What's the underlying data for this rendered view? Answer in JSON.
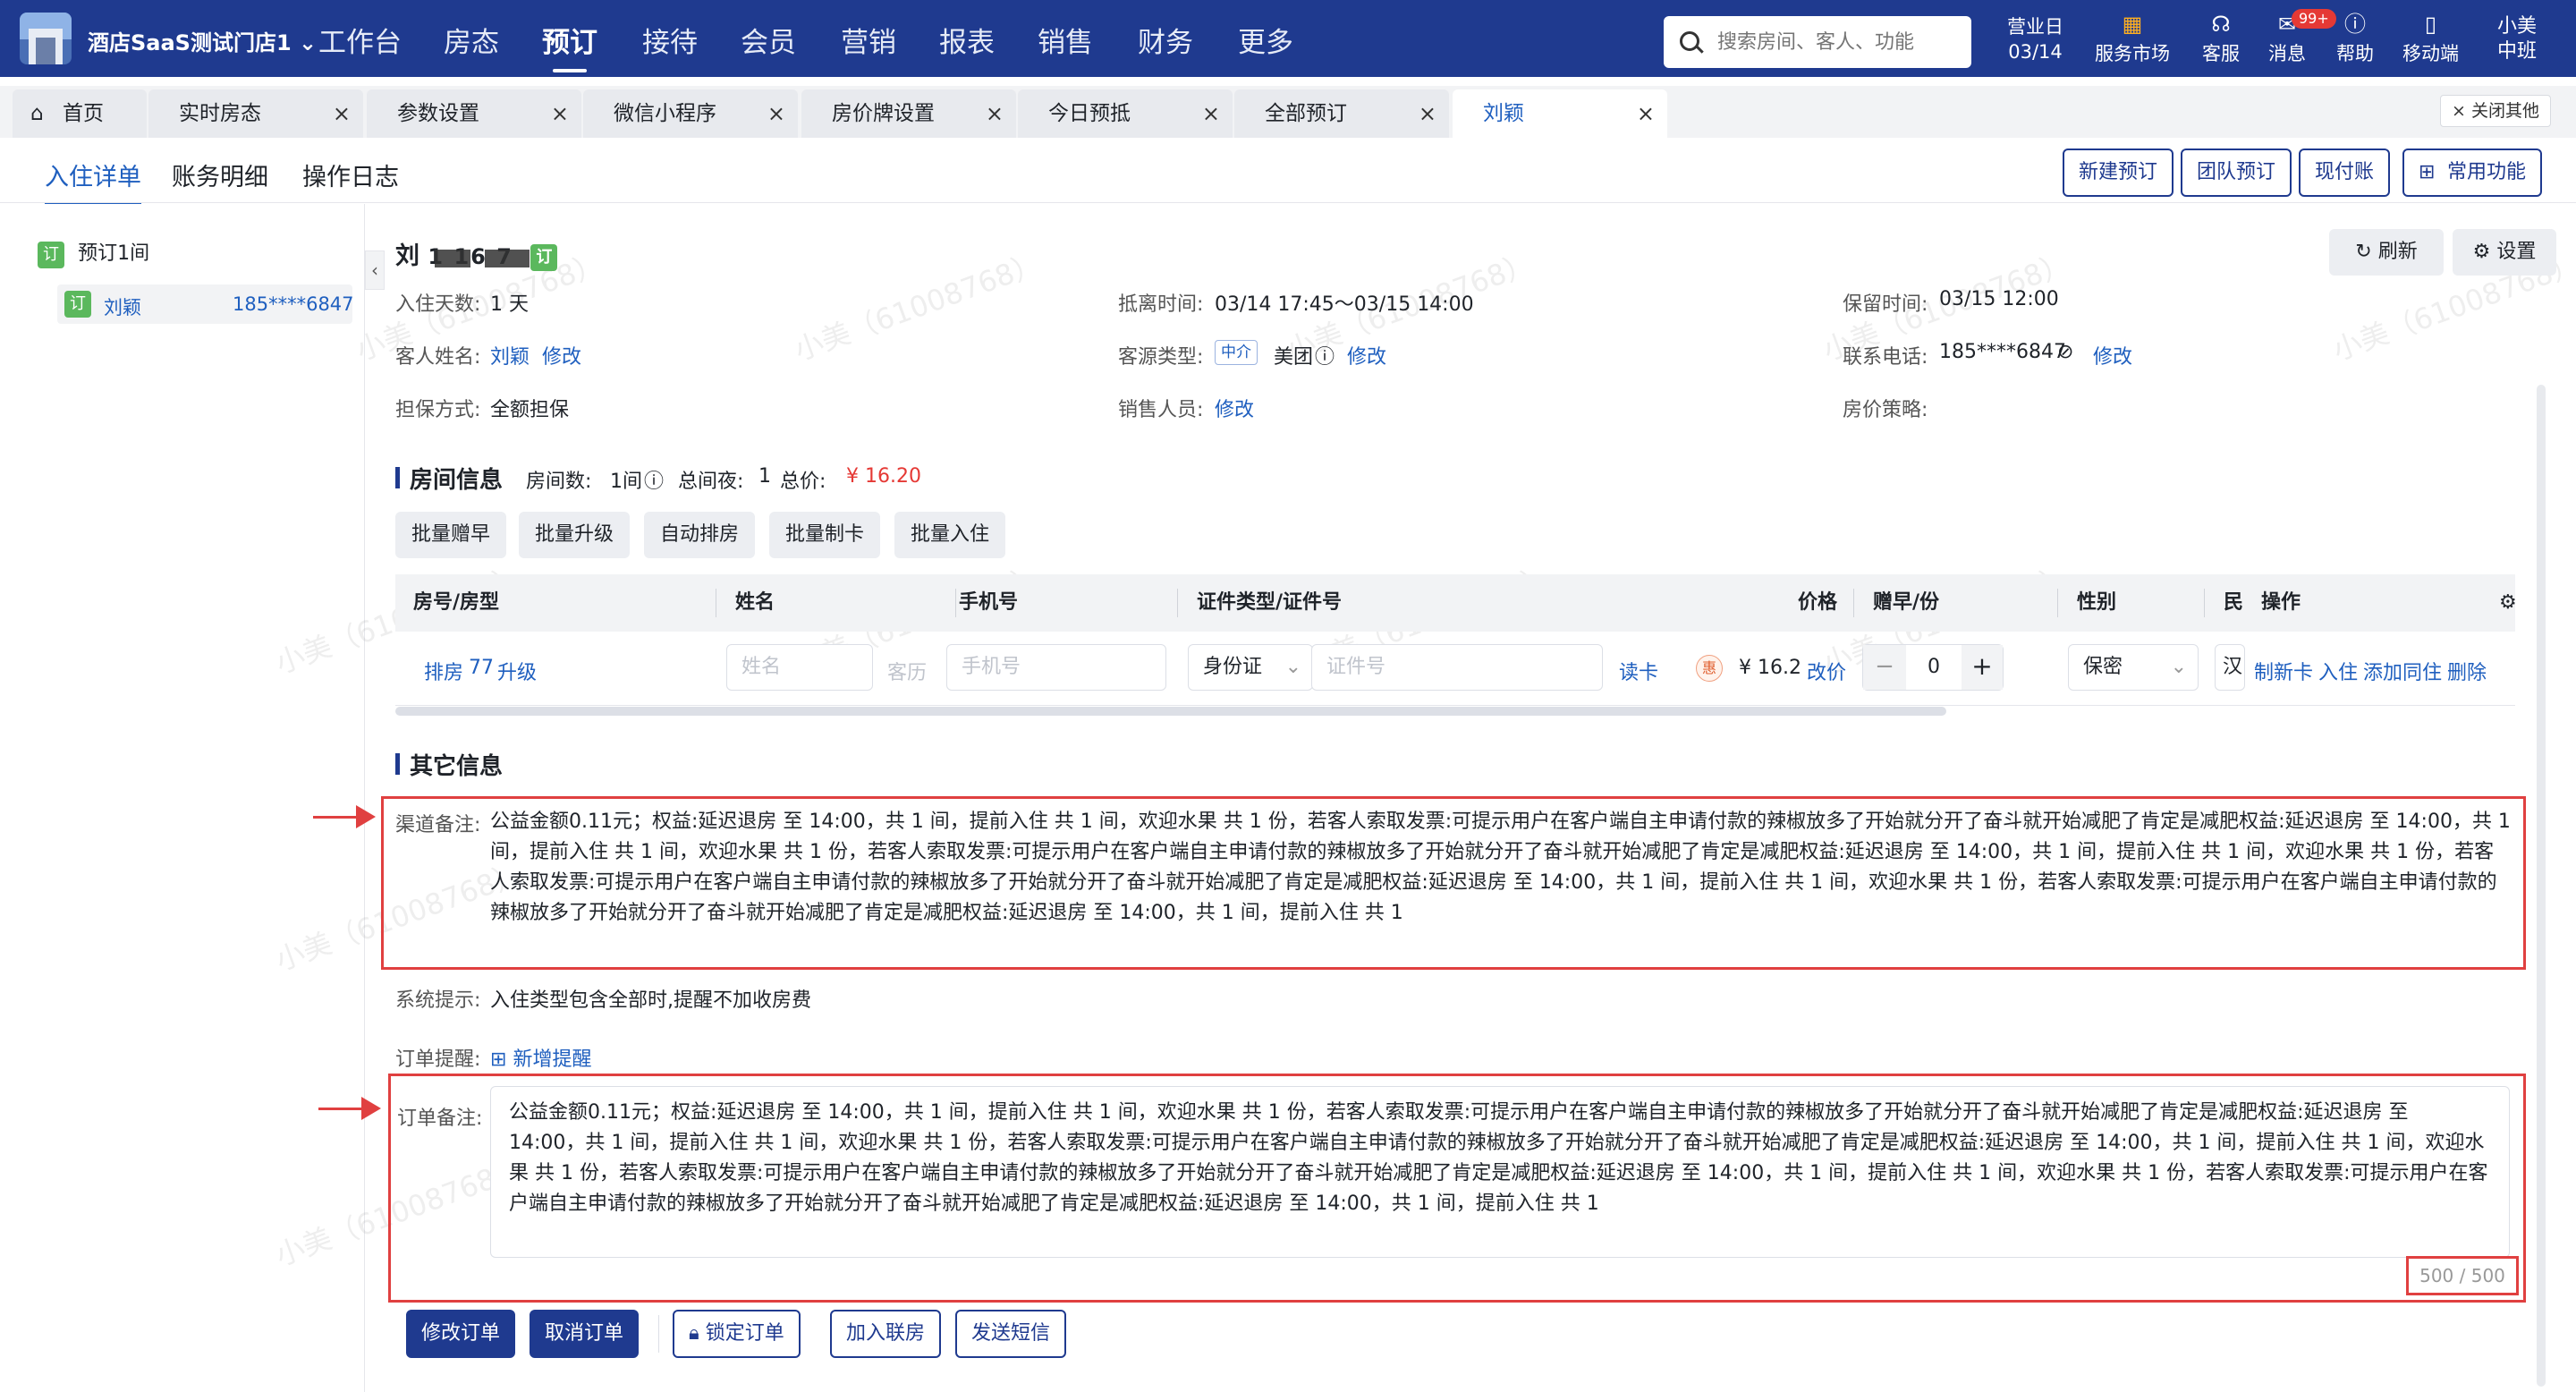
{
  "topbar": {
    "store_name": "酒店SaaS测试门店1",
    "nav": [
      "工作台",
      "房态",
      "预订",
      "接待",
      "会员",
      "营销",
      "报表",
      "销售",
      "财务",
      "更多"
    ],
    "active_nav": "预订",
    "search_placeholder": "搜索房间、客人、功能",
    "business_day_label": "营业日",
    "business_day": "03/14",
    "service_market": "服务市场",
    "customer_service": "客服",
    "messages": "消息",
    "messages_badge": "99+",
    "help": "帮助",
    "mobile": "移动端",
    "user_name": "小美",
    "user_shift": "中班"
  },
  "tabs": [
    {
      "label": "首页",
      "closable": false
    },
    {
      "label": "实时房态",
      "closable": true
    },
    {
      "label": "参数设置",
      "closable": true
    },
    {
      "label": "微信小程序",
      "closable": true
    },
    {
      "label": "房价牌设置",
      "closable": true
    },
    {
      "label": "今日预抵",
      "closable": true
    },
    {
      "label": "全部预订",
      "closable": true
    },
    {
      "label": "刘颖",
      "closable": true,
      "active": true
    }
  ],
  "close_others": "× 关闭其他",
  "subtabs": [
    "入住详单",
    "账务明细",
    "操作日志"
  ],
  "top_buttons": [
    "新建预订",
    "团队预订",
    "现付账",
    "常用功能"
  ],
  "left": {
    "group_tag": "订",
    "group_label": "预订1间",
    "guest_tag": "订",
    "guest_name": "刘颖",
    "guest_phone": "185****6847"
  },
  "header": {
    "name_prefix": "刘",
    "name_rest": "1  16  7",
    "tag": "订",
    "refresh": "刷新",
    "settings": "设置"
  },
  "info": {
    "days_label": "入住天数:",
    "days": "1 天",
    "stay_label": "抵离时间:",
    "stay": "03/14 17:45～03/15 14:00",
    "hold_label": "保留时间:",
    "hold": "03/15 12:00",
    "guest_label": "客人姓名:",
    "guest": "刘颖",
    "edit": "修改",
    "source_label": "客源类型:",
    "source_tag": "中介",
    "source": "美团",
    "phone_label": "联系电话:",
    "phone": "185****6847",
    "guarantee_label": "担保方式:",
    "guarantee": "全额担保",
    "sales_label": "销售人员:",
    "strategy_label": "房价策略:"
  },
  "room_info": {
    "title": "房间信息",
    "count_label": "房间数:",
    "count": "1间",
    "nights_label": "总间夜:",
    "nights": "1",
    "total_label": "总价:",
    "total": "¥ 16.20",
    "batch_buttons": [
      "批量赠早",
      "批量升级",
      "自动排房",
      "批量制卡",
      "批量入住"
    ],
    "columns": [
      "房号/房型",
      "姓名",
      "手机号",
      "证件类型/证件号",
      "价格",
      "赠早/份",
      "性别",
      "民",
      "操作"
    ],
    "row": {
      "room": "排房",
      "room_no": "77",
      "upgrade": "升级",
      "name_placeholder": "姓名",
      "history": "客历",
      "phone_placeholder": "手机号",
      "id_type": "身份证",
      "id_placeholder": "证件号",
      "read_card": "读卡",
      "hui": "惠",
      "price": "¥ 16.2",
      "change_price": "改价",
      "breakfast": "0",
      "gender": "保密",
      "nation": "汉",
      "actions": [
        "制新卡",
        "入住",
        "添加同住",
        "删除"
      ]
    }
  },
  "other": {
    "title": "其它信息",
    "channel_label": "渠道备注:",
    "channel_text": "公益金额0.11元；权益:延迟退房 至 14:00，共 1 间，提前入住 共 1 间，欢迎水果 共 1 份，若客人索取发票:可提示用户在客户端自主申请付款的辣椒放多了开始就分开了奋斗就开始减肥了肯定是减肥权益:延迟退房 至 14:00，共 1 间，提前入住 共 1 间，欢迎水果 共 1 份，若客人索取发票:可提示用户在客户端自主申请付款的辣椒放多了开始就分开了奋斗就开始减肥了肯定是减肥权益:延迟退房 至 14:00，共 1 间，提前入住 共 1 间，欢迎水果 共 1 份，若客人索取发票:可提示用户在客户端自主申请付款的辣椒放多了开始就分开了奋斗就开始减肥了肯定是减肥权益:延迟退房 至 14:00，共 1 间，提前入住 共 1 间，欢迎水果 共 1 份，若客人索取发票:可提示用户在客户端自主申请付款的辣椒放多了开始就分开了奋斗就开始减肥了肯定是减肥权益:延迟退房 至 14:00，共 1 间，提前入住 共 1",
    "system_label": "系统提示:",
    "system_text": "入住类型包含全部时,提醒不加收房费",
    "remind_label": "订单提醒:",
    "remind_add": "新增提醒",
    "order_label": "订单备注:",
    "order_text": "公益金额0.11元；权益:延迟退房 至 14:00，共 1 间，提前入住 共 1 间，欢迎水果 共 1 份，若客人索取发票:可提示用户在客户端自主申请付款的辣椒放多了开始就分开了奋斗就开始减肥了肯定是减肥权益:延迟退房 至 14:00，共 1 间，提前入住 共 1 间，欢迎水果 共 1 份，若客人索取发票:可提示用户在客户端自主申请付款的辣椒放多了开始就分开了奋斗就开始减肥了肯定是减肥权益:延迟退房 至 14:00，共 1 间，提前入住 共 1 间，欢迎水果 共 1 份，若客人索取发票:可提示用户在客户端自主申请付款的辣椒放多了开始就分开了奋斗就开始减肥了肯定是减肥权益:延迟退房 至 14:00，共 1 间，提前入住 共 1 间，欢迎水果 共 1 份，若客人索取发票:可提示用户在客户端自主申请付款的辣椒放多了开始就分开了奋斗就开始减肥了肯定是减肥权益:延迟退房 至 14:00，共 1 间，提前入住 共 1",
    "counter": "500 / 500"
  },
  "footer_buttons": {
    "modify": "修改订单",
    "cancel": "取消订单",
    "lock": "锁定订单",
    "join": "加入联房",
    "sms": "发送短信"
  },
  "watermark": "小美（61008768）",
  "colors": {
    "primary": "#1f3a8f",
    "link": "#1f5fbf",
    "annotation": "#e04040",
    "price": "#e53935",
    "tag_green": "#5bb85d"
  }
}
